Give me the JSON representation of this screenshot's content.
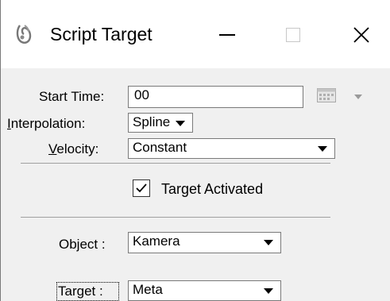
{
  "window": {
    "title": "Script Target",
    "icon": "script-target-icon",
    "controls": {
      "minimize": "minimize-icon",
      "maximize": "maximize-icon",
      "close": "close-icon"
    }
  },
  "form": {
    "start_time": {
      "label": "Start Time:",
      "value": "00"
    },
    "interpolation": {
      "label_prefix": "",
      "label_ul": "I",
      "label_rest": "nterpolation:",
      "value": "Spline"
    },
    "velocity": {
      "label_prefix": "",
      "label_ul": "V",
      "label_rest": "elocity:",
      "value": "Constant"
    },
    "target_activated": {
      "label": "Target Activated",
      "checked": true
    },
    "object": {
      "label": "Object :",
      "value": "Kamera"
    },
    "target": {
      "label": "Target :",
      "value": "Meta"
    }
  },
  "colors": {
    "titlebar_bg": "#ffffff",
    "dialog_bg": "#f0f0f0",
    "border": "#7a7a7a",
    "separator": "#a0a0a0"
  }
}
